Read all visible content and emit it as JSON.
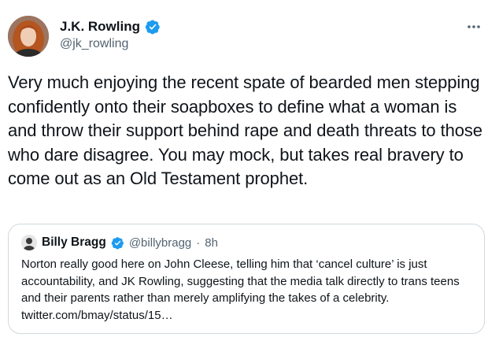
{
  "tweet": {
    "author": {
      "display_name": "J.K. Rowling",
      "handle": "@jk_rowling",
      "verified_color": "#1d9bf0"
    },
    "text": "Very much enjoying the recent spate of bearded men stepping confidently onto their soapboxes to define what a woman is and throw their support behind rape and death threats to those who dare disagree. You may mock, but takes real bravery to come out as an Old Testament prophet.",
    "more_icon": "more-horizontal-icon"
  },
  "quote": {
    "display_name": "Billy Bragg",
    "handle": "@billybragg",
    "separator": "·",
    "time": "8h",
    "text": "Norton really good here on John Cleese, telling him that ‘cancel culture’ is just accountability, and JK Rowling, suggesting that the media talk directly to trans teens and their parents rather than merely amplifying the takes of a celebrity. twitter.com/bmay/status/15…"
  }
}
